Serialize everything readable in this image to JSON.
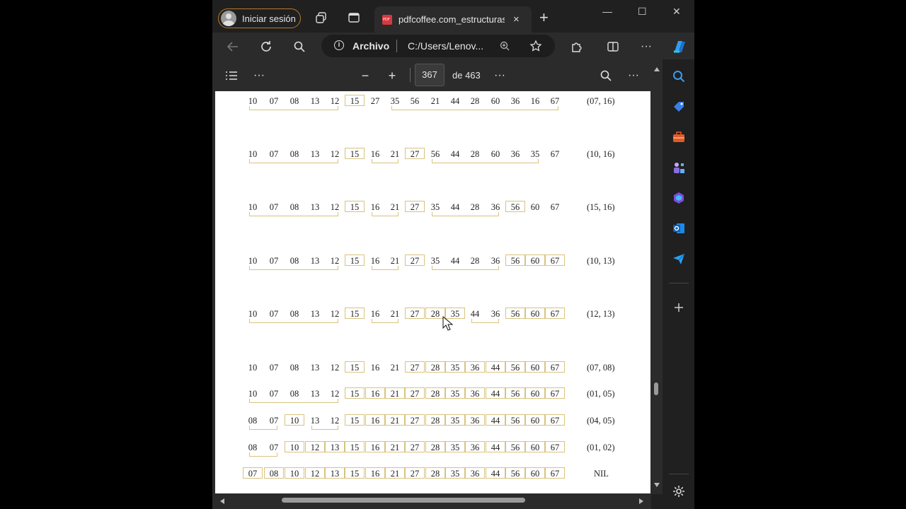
{
  "browser": {
    "profile_label": "Iniciar sesión",
    "tab_title": "pdfcoffee.com_estructuras",
    "tab_close": "×",
    "new_tab": "+",
    "window_controls": [
      "—",
      "☐",
      "✕"
    ],
    "address_label": "Archivo",
    "url": "C:/Users/Lenov..."
  },
  "pdf_toolbar": {
    "zoom_out": "−",
    "zoom_in": "+",
    "page_current": "367",
    "page_total": "de 463",
    "more": "···"
  },
  "document": {
    "rows": [
      {
        "numbers": [
          "10",
          "07",
          "08",
          "13",
          "12",
          "15",
          "27",
          "35",
          "56",
          "21",
          "44",
          "28",
          "60",
          "36",
          "16",
          "67"
        ],
        "boxed": [
          5
        ],
        "pair": "(07, 16)"
      },
      {
        "numbers": [
          "10",
          "07",
          "08",
          "13",
          "12",
          "15",
          "16",
          "21",
          "27",
          "56",
          "44",
          "28",
          "60",
          "36",
          "35",
          "67"
        ],
        "boxed": [
          5,
          8
        ],
        "pair": "(10, 16)"
      },
      {
        "numbers": [
          "10",
          "07",
          "08",
          "13",
          "12",
          "15",
          "16",
          "21",
          "27",
          "35",
          "44",
          "28",
          "36",
          "56",
          "60",
          "67"
        ],
        "boxed": [
          5,
          8,
          13
        ],
        "pair": "(15, 16)"
      },
      {
        "numbers": [
          "10",
          "07",
          "08",
          "13",
          "12",
          "15",
          "16",
          "21",
          "27",
          "35",
          "44",
          "28",
          "36",
          "56",
          "60",
          "67"
        ],
        "boxed": [
          5,
          8,
          13,
          14,
          15
        ],
        "pair": "(10, 13)"
      },
      {
        "numbers": [
          "10",
          "07",
          "08",
          "13",
          "12",
          "15",
          "16",
          "21",
          "27",
          "28",
          "35",
          "44",
          "36",
          "56",
          "60",
          "67"
        ],
        "boxed": [
          5,
          8,
          9,
          10,
          13,
          14,
          15
        ],
        "pair": "(12, 13)"
      },
      {
        "numbers": [
          "10",
          "07",
          "08",
          "13",
          "12",
          "15",
          "16",
          "21",
          "27",
          "28",
          "35",
          "36",
          "44",
          "56",
          "60",
          "67"
        ],
        "boxed": [
          5,
          8,
          9,
          10,
          11,
          12,
          13,
          14,
          15
        ],
        "pair": "(07, 08)"
      },
      {
        "numbers": [
          "10",
          "07",
          "08",
          "13",
          "12",
          "15",
          "16",
          "21",
          "27",
          "28",
          "35",
          "36",
          "44",
          "56",
          "60",
          "67"
        ],
        "boxed": [
          5,
          6,
          7,
          8,
          9,
          10,
          11,
          12,
          13,
          14,
          15
        ],
        "pair": "(01, 05)"
      },
      {
        "numbers": [
          "08",
          "07",
          "10",
          "13",
          "12",
          "15",
          "16",
          "21",
          "27",
          "28",
          "35",
          "36",
          "44",
          "56",
          "60",
          "67"
        ],
        "boxed": [
          2,
          5,
          6,
          7,
          8,
          9,
          10,
          11,
          12,
          13,
          14,
          15
        ],
        "pair": "(04, 05)"
      },
      {
        "numbers": [
          "08",
          "07",
          "10",
          "12",
          "13",
          "15",
          "16",
          "21",
          "27",
          "28",
          "35",
          "36",
          "44",
          "56",
          "60",
          "67"
        ],
        "boxed": [
          2,
          3,
          4,
          5,
          6,
          7,
          8,
          9,
          10,
          11,
          12,
          13,
          14,
          15
        ],
        "pair": "(01, 02)"
      },
      {
        "numbers": [
          "07",
          "08",
          "10",
          "12",
          "13",
          "15",
          "16",
          "21",
          "27",
          "28",
          "35",
          "36",
          "44",
          "56",
          "60",
          "67"
        ],
        "boxed": [
          0,
          1,
          2,
          3,
          4,
          5,
          6,
          7,
          8,
          9,
          10,
          11,
          12,
          13,
          14,
          15
        ],
        "pair": "NIL"
      }
    ]
  },
  "colors": {
    "box_border": "#d8c37e",
    "profile_border": "#b87a2c"
  }
}
